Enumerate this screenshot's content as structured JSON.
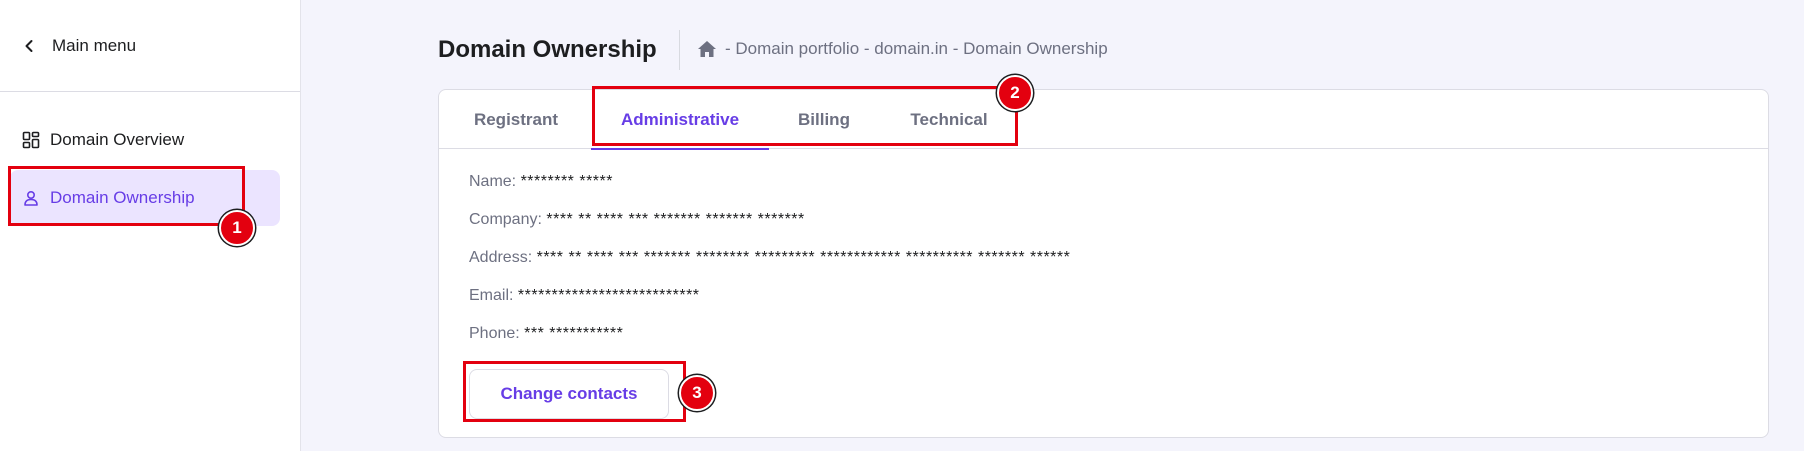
{
  "sidebar": {
    "main_menu_label": "Main menu",
    "items": [
      {
        "label": "Domain Overview",
        "icon": "dashboard-grid-icon",
        "active": false
      },
      {
        "label": "Domain Ownership",
        "icon": "person-icon",
        "active": true
      }
    ]
  },
  "header": {
    "title": "Domain Ownership",
    "breadcrumb_icon": "home-icon",
    "breadcrumb": "- Domain portfolio - domain.in - Domain Ownership"
  },
  "tabs": [
    {
      "label": "Registrant",
      "active": false
    },
    {
      "label": "Administrative",
      "active": true
    },
    {
      "label": "Billing",
      "active": false
    },
    {
      "label": "Technical",
      "active": false
    }
  ],
  "contact": {
    "name_label": "Name:",
    "name_value": "******** *****",
    "company_label": "Company:",
    "company_value": "**** ** **** *** ******* ******* *******",
    "address_label": "Address:",
    "address_value": "**** ** **** *** ******* ******** ********* ************ ********** ******* ******",
    "email_label": "Email:",
    "email_value": "***************************",
    "phone_label": "Phone:",
    "phone_value": "*** ***********"
  },
  "actions": {
    "change_contacts_label": "Change contacts"
  },
  "annotations": {
    "badge_1": "1",
    "badge_2": "2",
    "badge_3": "3",
    "color": "#e3000f"
  },
  "colors": {
    "accent": "#673de6",
    "active_bg": "#ebe4ff",
    "page_bg": "#f4f4fc",
    "muted_text": "#6d7081"
  }
}
